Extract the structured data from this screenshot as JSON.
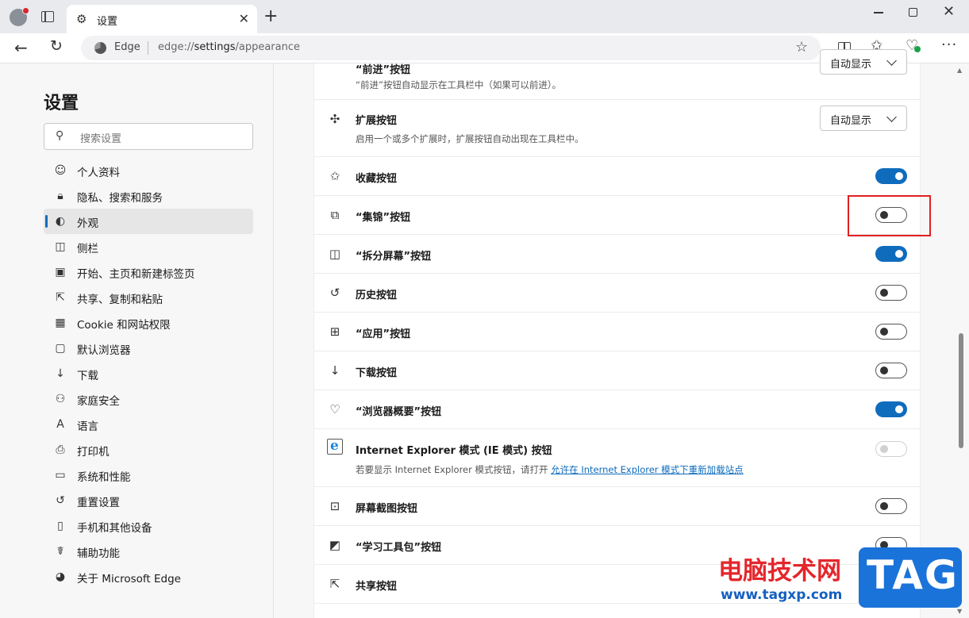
{
  "window": {
    "tab_title": "设置",
    "tab_close": "✕",
    "new_tab": "+",
    "minimize": "",
    "close": "✕"
  },
  "address": {
    "site_label": "Edge",
    "url_scheme": "edge://",
    "url_host": "settings",
    "url_path": "/appearance"
  },
  "sidebar": {
    "title": "设置",
    "search_placeholder": "搜索设置",
    "items": [
      {
        "label": "个人资料"
      },
      {
        "label": "隐私、搜索和服务"
      },
      {
        "label": "外观"
      },
      {
        "label": "侧栏"
      },
      {
        "label": "开始、主页和新建标签页"
      },
      {
        "label": "共享、复制和粘贴"
      },
      {
        "label": "Cookie 和网站权限"
      },
      {
        "label": "默认浏览器"
      },
      {
        "label": "下载"
      },
      {
        "label": "家庭安全"
      },
      {
        "label": "语言"
      },
      {
        "label": "打印机"
      },
      {
        "label": "系统和性能"
      },
      {
        "label": "重置设置"
      },
      {
        "label": "手机和其他设备"
      },
      {
        "label": "辅助功能"
      },
      {
        "label": "关于 Microsoft Edge"
      }
    ]
  },
  "settings": {
    "forward": {
      "title": "“前进”按钮",
      "desc": "“前进”按钮自动显示在工具栏中（如果可以前进）。",
      "dropdown": "自动显示"
    },
    "extensions": {
      "title": "扩展按钮",
      "desc": "启用一个或多个扩展时，扩展按钮自动出现在工具栏中。",
      "dropdown": "自动显示"
    },
    "favorites": {
      "title": "收藏按钮",
      "on": true
    },
    "collections": {
      "title": "“集锦”按钮",
      "on": false
    },
    "split": {
      "title": "“拆分屏幕”按钮",
      "on": true
    },
    "history": {
      "title": "历史按钮",
      "on": false
    },
    "apps": {
      "title": "“应用”按钮",
      "on": false
    },
    "downloads": {
      "title": "下载按钮",
      "on": false
    },
    "essentials": {
      "title": "“浏览器概要”按钮",
      "on": true
    },
    "ie": {
      "title": "Internet Explorer 模式 (IE 模式) 按钮",
      "desc_prefix": "若要显示 Internet Explorer 模式按钮，请打开 ",
      "desc_link": "允许在 Internet Explorer 模式下重新加载站点",
      "enabled": false
    },
    "screenshot": {
      "title": "屏幕截图按钮",
      "on": false
    },
    "learning": {
      "title": "“学习工具包”按钮",
      "on": false
    },
    "share": {
      "title": "共享按钮"
    }
  },
  "watermark": {
    "text": "电脑技术网",
    "url": "www.tagxp.com",
    "logo": "TAG"
  },
  "colors": {
    "accent": "#0f6cbd",
    "highlight": "#e02020"
  }
}
